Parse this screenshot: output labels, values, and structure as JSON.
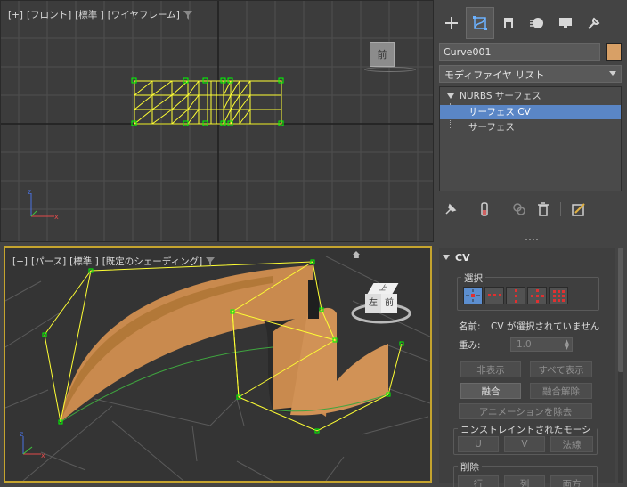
{
  "viewports": {
    "front": {
      "plus": "[+]",
      "view": "[フロント]",
      "quality": "[標準 ]",
      "shading": "[ワイヤフレーム]",
      "viewcube_label": "前"
    },
    "perspective": {
      "plus": "[+]",
      "view": "[パース]",
      "quality": "[標準 ]",
      "shading": "[既定のシェーディング]",
      "viewcube_top": "上",
      "viewcube_left": "左",
      "viewcube_front": "前"
    }
  },
  "panel": {
    "tabs": [
      "create-icon",
      "modify-icon",
      "hierarchy-icon",
      "motion-icon",
      "display-icon",
      "utilities-icon"
    ],
    "active_tab": "modify-icon",
    "object_name": "Curve001",
    "object_color": "#d8a066",
    "modifier_list": "モディファイヤ リスト",
    "stack": {
      "root": "NURBS サーフェス",
      "children": [
        "サーフェス CV",
        "サーフェス"
      ],
      "selected": "サーフェス CV"
    }
  },
  "rollout": {
    "title": "CV",
    "selection_group": "選択",
    "name_label": "名前:",
    "name_value": "CV が選択されていません",
    "weight_label": "重み:",
    "weight_value": "1.0",
    "buttons": {
      "hide": "非表示",
      "unhide_all": "すべて表示",
      "fuse": "融合",
      "unfuse": "融合解除",
      "remove_animation": "アニメーションを除去"
    },
    "constrained_group": "コンストレイントされたモーション",
    "constrained_buttons": [
      "U",
      "V",
      "法線"
    ],
    "delete_group": "削除",
    "delete_buttons": [
      "行",
      "列",
      "両方"
    ]
  },
  "colors": {
    "accent_blue": "#5c8ecf",
    "viewport_border_active": "#c5a42e",
    "surface_orange": "#c98a4e",
    "selection_yellow": "#f0f000",
    "cv_green": "#33cc33"
  }
}
